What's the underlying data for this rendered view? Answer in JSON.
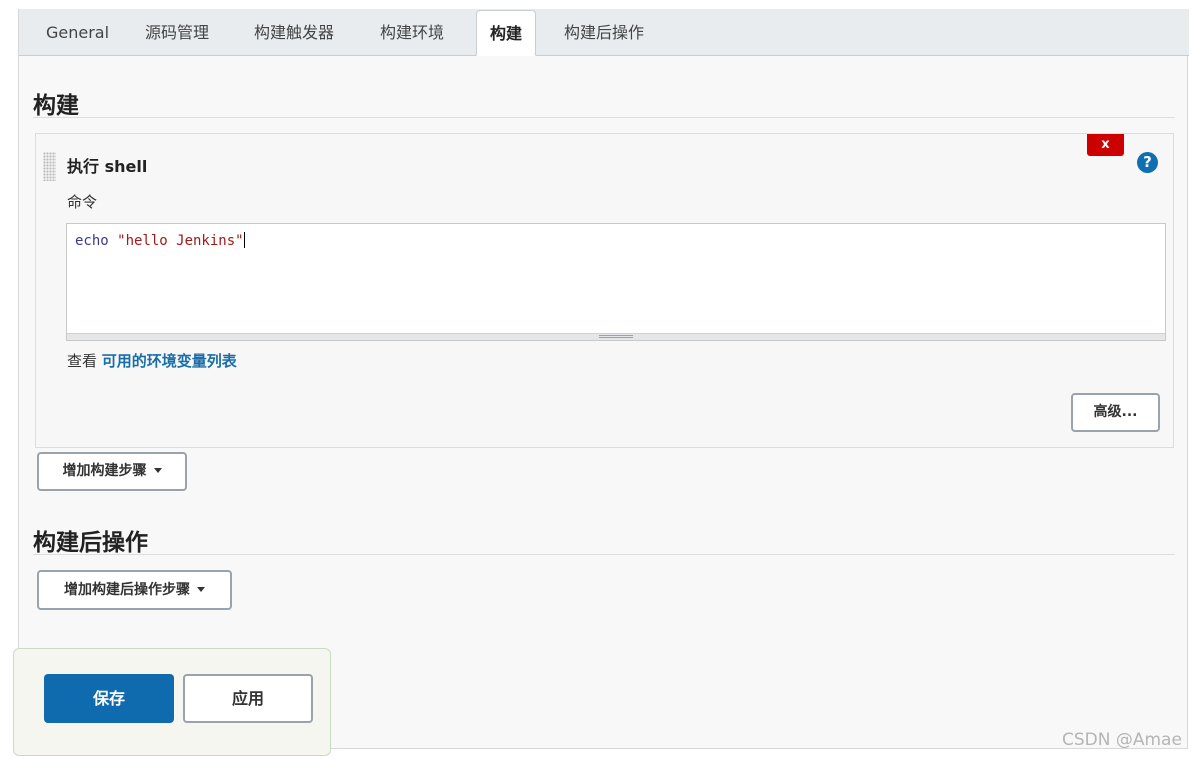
{
  "tabs": [
    {
      "label": "General"
    },
    {
      "label": "源码管理"
    },
    {
      "label": "构建触发器"
    },
    {
      "label": "构建环境"
    },
    {
      "label": "构建",
      "active": true
    },
    {
      "label": "构建后操作"
    }
  ],
  "build_section": {
    "title": "构建",
    "step": {
      "title": "执行 shell",
      "delete_label": "x",
      "help_label": "?",
      "command_label": "命令",
      "command_keyword": "echo",
      "command_string": " \"hello Jenkins\"",
      "env_prefix": "查看 ",
      "env_link": "可用的环境变量列表",
      "advanced_label": "高级..."
    },
    "add_step_label": "增加构建步骤"
  },
  "post_build_section": {
    "title": "构建后操作",
    "add_step_label": "增加构建后操作步骤"
  },
  "footer": {
    "save_label": "保存",
    "apply_label": "应用"
  },
  "watermark": "CSDN @Amae"
}
